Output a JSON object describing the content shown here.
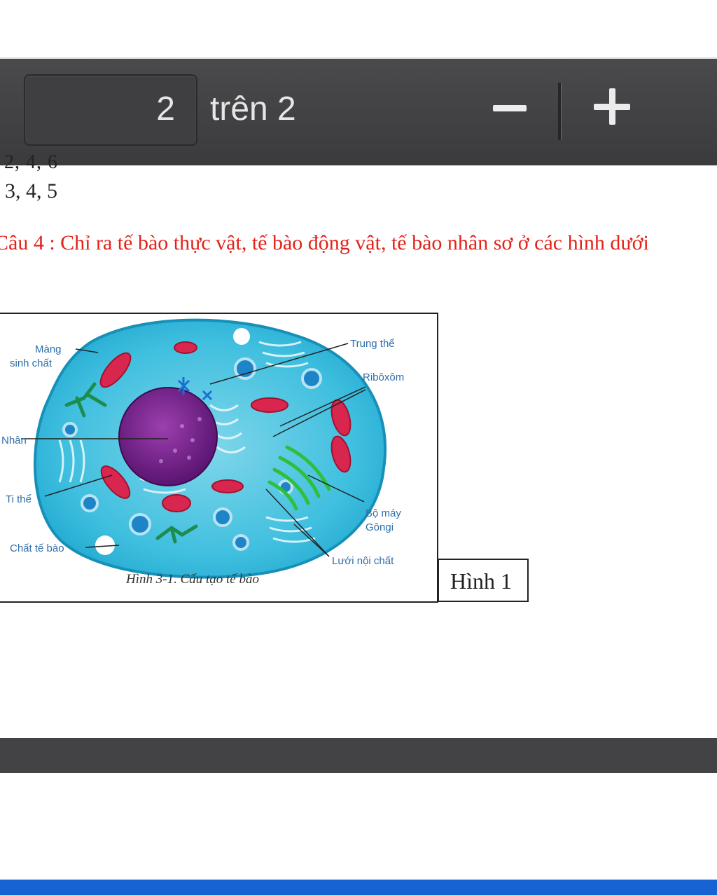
{
  "toolbar": {
    "current_page": "2",
    "page_total_label": "trên 2",
    "zoom_out_icon": "minus-icon",
    "zoom_in_icon": "plus-icon"
  },
  "document": {
    "partial_answer": ". 2, 4, 6",
    "answer_d": ". 3, 4, 5",
    "question": "Câu 4 : Chỉ ra tế bào thực vật, tế bào động vật, tế bào nhân sơ ở các hình dưới",
    "figure_caption": "Hình 3-1. Cấu tạo tế bào",
    "figure_tag": "Hình 1",
    "labels": {
      "mang": "Màng",
      "sinh_chat": "sinh chất",
      "nhan": "Nhân",
      "ti_the": "Ti thể",
      "chat_te_bao": "Chất tế bào",
      "trung_the": "Trung thể",
      "ribosom": "Ribôxôm",
      "bo_may": "Bộ máy",
      "gongi": "Gôngi",
      "luoi_noi_chat": "Lưới nội chất"
    }
  },
  "colors": {
    "toolbar": "#3f3f41",
    "question_text": "#e32219",
    "accent_strip": "#1763d4"
  }
}
